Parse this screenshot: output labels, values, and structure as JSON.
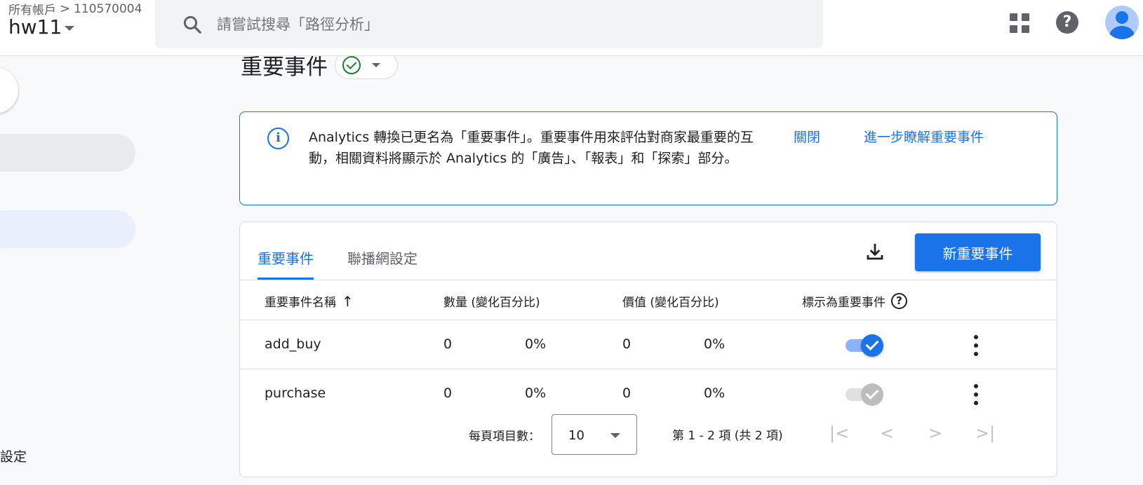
{
  "topbar": {
    "breadcrumb_root": "所有帳戶",
    "breadcrumb_chevron": ">",
    "account_id": "110570004",
    "property_name": "hw11",
    "search_placeholder": "請嘗試搜尋「路徑分析」"
  },
  "sidebar": {
    "partial_label": "設定"
  },
  "page": {
    "title": "重要事件"
  },
  "banner": {
    "text": "Analytics 轉換已更名為「重要事件」。重要事件用來評估對商家最重要的互動，相關資料將顯示於 Analytics 的「廣告」、「報表」和「探索」部分。",
    "close_label": "關閉",
    "learn_more_label": "進一步瞭解重要事件"
  },
  "tabs": [
    {
      "label": "重要事件",
      "active": true
    },
    {
      "label": "聯播網設定",
      "active": false
    }
  ],
  "actions": {
    "new_event_label": "新重要事件"
  },
  "table": {
    "headers": {
      "name": "重要事件名稱",
      "count": "數量 (變化百分比)",
      "value": "價值 (變化百分比)",
      "mark": "標示為重要事件"
    },
    "rows": [
      {
        "name": "add_buy",
        "count": "0",
        "count_change": "0%",
        "value": "0",
        "value_change": "0%",
        "marked": true,
        "toggle_state": "on"
      },
      {
        "name": "purchase",
        "count": "0",
        "count_change": "0%",
        "value": "0",
        "value_change": "0%",
        "marked": true,
        "toggle_state": "disabled"
      }
    ]
  },
  "pagination": {
    "items_per_page_label": "每頁項目數：",
    "page_size": "10",
    "range_text": "第 1 - 2 項 (共 2 項)"
  },
  "colors": {
    "accent": "#1a73e8",
    "success": "#188038"
  },
  "icons": [
    "search-icon",
    "apps-icon",
    "help-icon",
    "avatar",
    "check-circle-icon",
    "info-icon",
    "download-icon",
    "sort-arrow-icon",
    "help-circle-icon",
    "more-vert-icon",
    "first-page-icon",
    "prev-page-icon",
    "next-page-icon",
    "last-page-icon"
  ]
}
